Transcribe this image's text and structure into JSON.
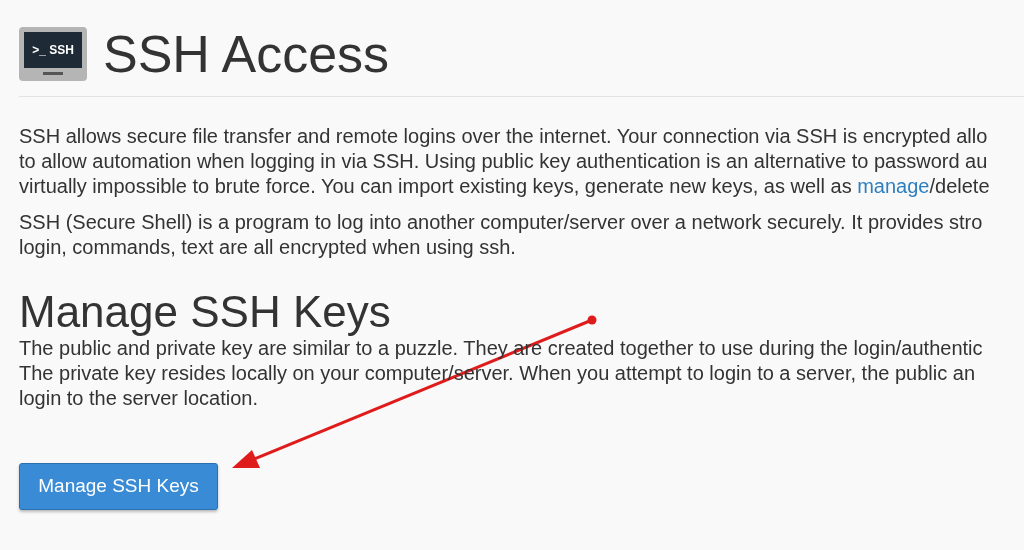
{
  "header": {
    "icon_label": ">_ SSH",
    "title": "SSH Access"
  },
  "intro": {
    "lines": [
      {
        "text": "SSH allows secure file transfer and remote logins over the internet. Your connection via SSH is encrypted allo"
      },
      {
        "text": "to allow automation when logging in via SSH. Using public key authentication is an alternative to password au"
      },
      {
        "text": "virtually impossible to brute force. You can import existing keys, generate new keys, as well as ",
        "link": "manage",
        "after": "/delete"
      }
    ]
  },
  "about": {
    "lines": [
      "SSH (Secure Shell) is a program to log into another computer/server over a network securely. It provides stro",
      "login, commands, text are all encrypted when using ssh."
    ]
  },
  "section": {
    "title": "Manage SSH Keys",
    "lines": [
      "The public and private key are similar to a puzzle. They are created together to use during the login/authentic",
      "The private key resides locally on your computer/server. When you attempt to login to a server, the public an",
      "login to the server location."
    ],
    "button": "Manage SSH Keys"
  }
}
